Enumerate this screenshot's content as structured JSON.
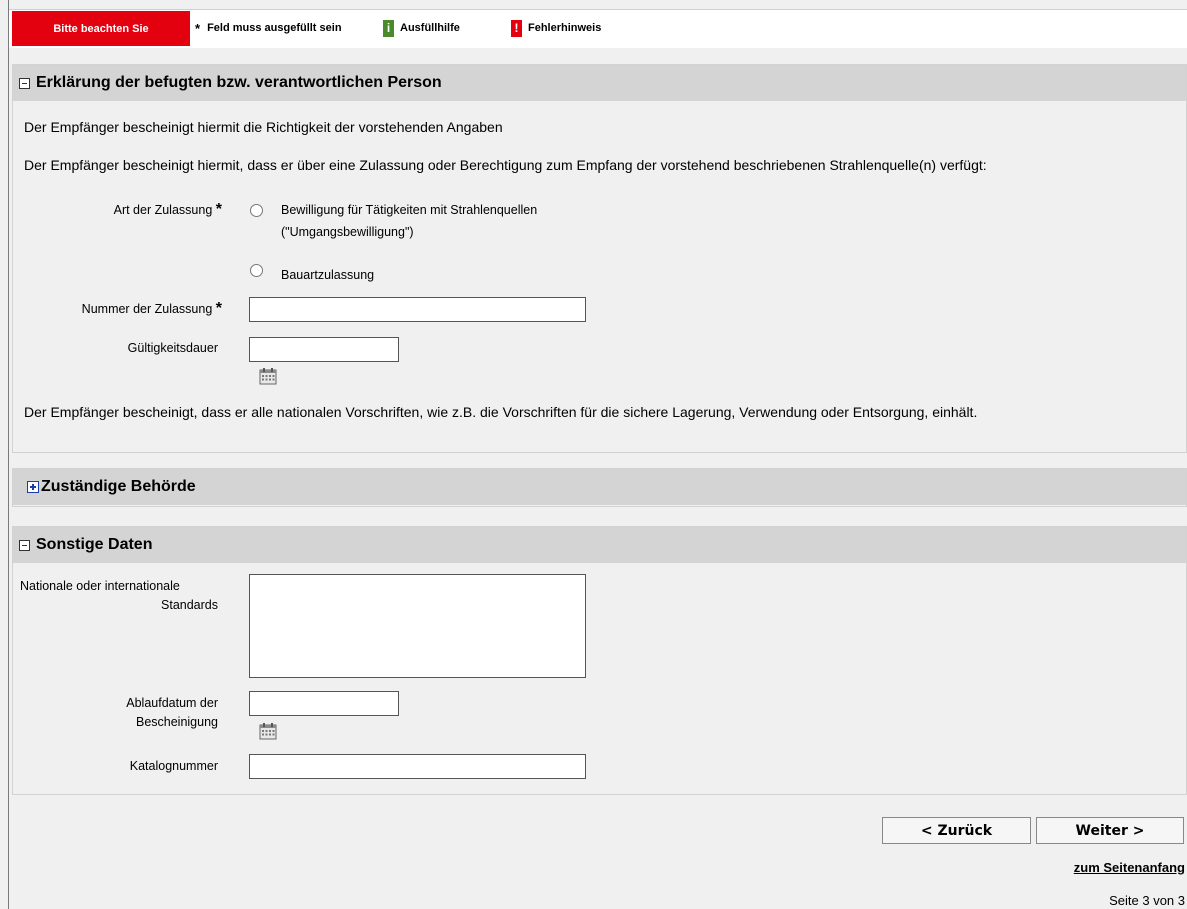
{
  "legend": {
    "note": "Bitte beachten Sie",
    "required_symbol": "*",
    "required": "Feld muss ausgefüllt sein",
    "help_symbol": "i",
    "help": "Ausfüllhilfe",
    "error_symbol": "!",
    "error": "Fehlerhinweis"
  },
  "section1": {
    "title": "Erklärung der befugten bzw. verantwortlichen Person",
    "line1": "Der Empfänger bescheinigt hiermit die Richtigkeit der vorstehenden Angaben",
    "line2": "Der Empfänger bescheinigt hiermit, dass er über eine Zulassung oder Berechtigung zum Empfang der vorstehend beschriebenen Strahlenquelle(n) verfügt:",
    "art_label": "Art der Zulassung",
    "option1_line1": "Bewilligung für Tätigkeiten mit Strahlenquellen",
    "option1_line2": "(\"Umgangsbewilligung\")",
    "option2": "Bauartzulassung",
    "nummer_label": "Nummer der Zulassung",
    "nummer_value": "",
    "gueltig_label": "Gültigkeitsdauer",
    "gueltig_value": "",
    "closing": "Der Empfänger bescheinigt, dass er alle nationalen Vorschriften, wie z.B. die Vorschriften für die sichere Lagerung, Verwendung oder Entsorgung, einhält."
  },
  "section2": {
    "title": "Zuständige Behörde"
  },
  "section3": {
    "title": "Sonstige Daten",
    "standards_label_1": "Nationale oder internationale",
    "standards_label_2": "Standards",
    "standards_value": "",
    "ablauf_label_1": "Ablaufdatum der",
    "ablauf_label_2": "Bescheinigung",
    "ablauf_value": "",
    "katalog_label": "Katalognummer",
    "katalog_value": ""
  },
  "nav": {
    "back": "< Zurück",
    "next": "Weiter >",
    "top_link": "zum Seitenanfang",
    "page_info": "Seite 3 von 3"
  },
  "colors": {
    "accent_red": "#e3000f",
    "help_green": "#4a8a2a",
    "header_gray": "#d4d4d4"
  },
  "icons": [
    "calendar-icon",
    "collapse-icon",
    "expand-icon"
  ]
}
